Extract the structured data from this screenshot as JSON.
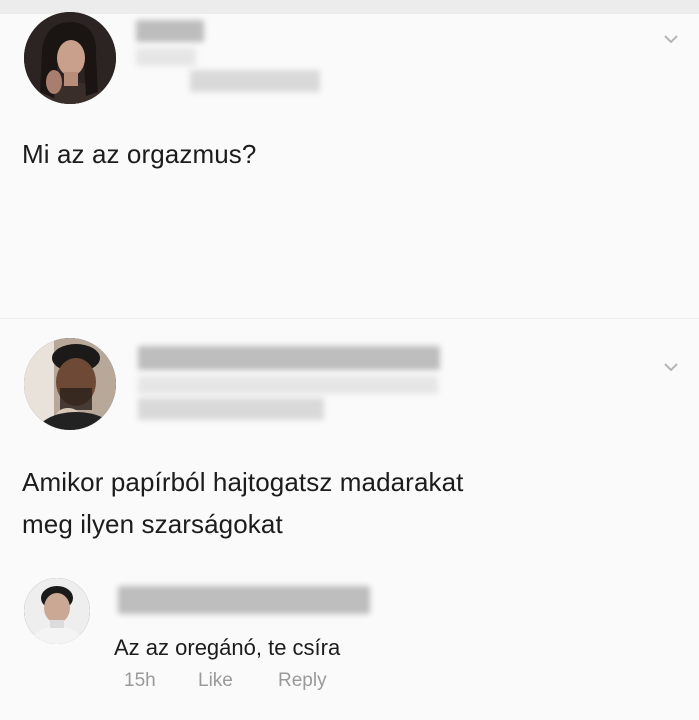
{
  "post": {
    "text": "Mi az az orgazmus?"
  },
  "comment": {
    "text_line1": "Amikor papírból hajtogatsz madarakat",
    "text_line2": "meg ilyen szarságokat"
  },
  "reply": {
    "text": "Az az oregánó, te csíra",
    "time": "15h",
    "like_label": "Like",
    "reply_label": "Reply"
  },
  "icons": {
    "post_menu": "chevron-down-icon",
    "comment_menu": "chevron-down-icon"
  },
  "colors": {
    "text": "#1c1c1c",
    "meta": "#9a9a9a",
    "background": "#fafafa"
  }
}
